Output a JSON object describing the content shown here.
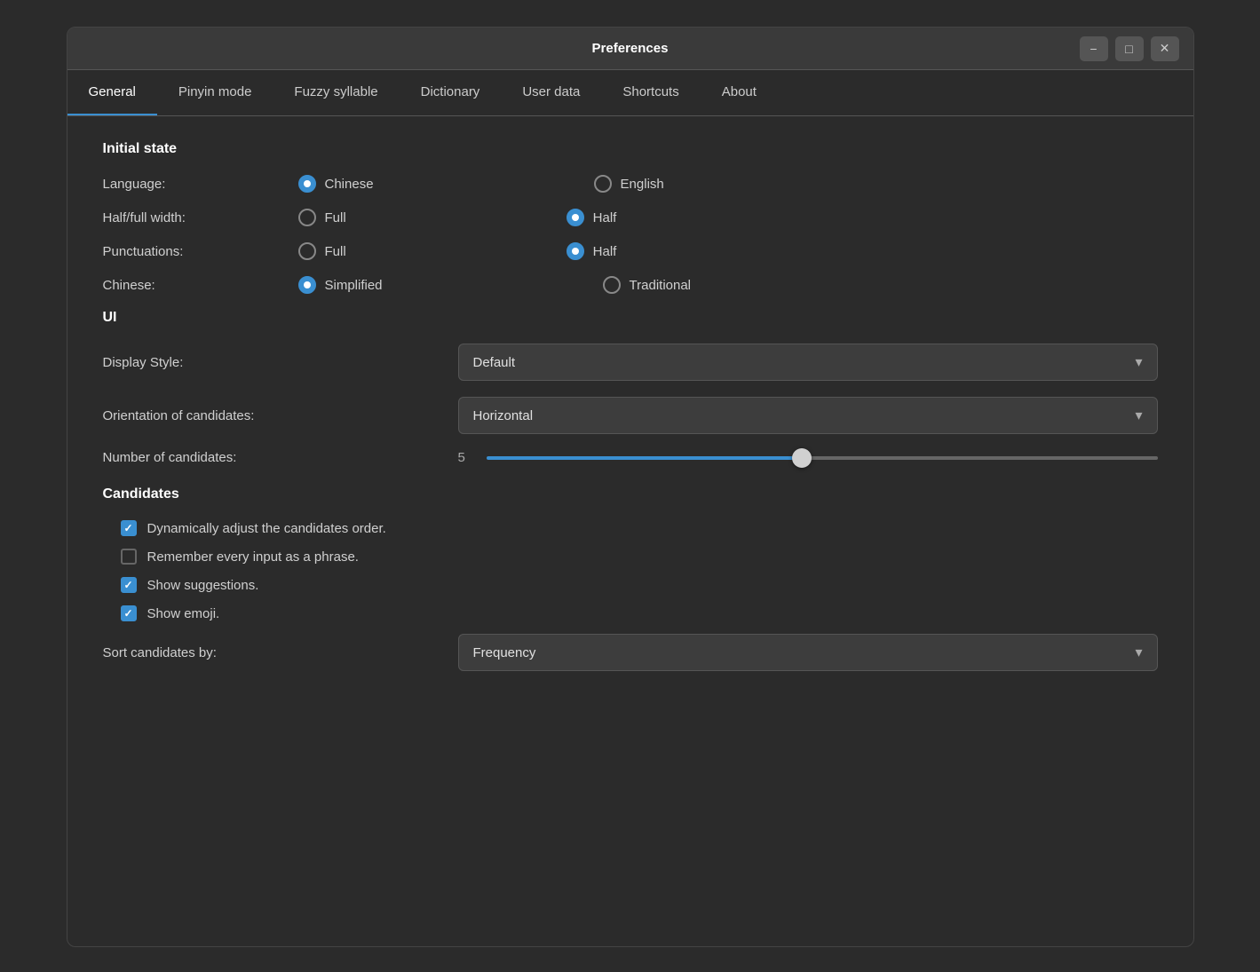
{
  "titlebar": {
    "title": "Preferences",
    "btn_minimize": "−",
    "btn_maximize": "□",
    "btn_close": "✕"
  },
  "tabs": [
    {
      "id": "general",
      "label": "General",
      "active": true
    },
    {
      "id": "pinyin",
      "label": "Pinyin mode",
      "active": false
    },
    {
      "id": "fuzzy",
      "label": "Fuzzy syllable",
      "active": false
    },
    {
      "id": "dictionary",
      "label": "Dictionary",
      "active": false
    },
    {
      "id": "userdata",
      "label": "User data",
      "active": false
    },
    {
      "id": "shortcuts",
      "label": "Shortcuts",
      "active": false
    },
    {
      "id": "about",
      "label": "About",
      "active": false
    }
  ],
  "initial_state": {
    "section_title": "Initial state",
    "language": {
      "label": "Language:",
      "options": [
        {
          "label": "Chinese",
          "selected": true
        },
        {
          "label": "English",
          "selected": false
        }
      ]
    },
    "half_full_width": {
      "label": "Half/full width:",
      "options": [
        {
          "label": "Full",
          "selected": false
        },
        {
          "label": "Half",
          "selected": true
        }
      ]
    },
    "punctuations": {
      "label": "Punctuations:",
      "options": [
        {
          "label": "Full",
          "selected": false
        },
        {
          "label": "Half",
          "selected": true
        }
      ]
    },
    "chinese": {
      "label": "Chinese:",
      "options": [
        {
          "label": "Simplified",
          "selected": true
        },
        {
          "label": "Traditional",
          "selected": false
        }
      ]
    }
  },
  "ui_section": {
    "section_title": "UI",
    "display_style": {
      "label": "Display Style:",
      "value": "Default"
    },
    "orientation": {
      "label": "Orientation of candidates:",
      "value": "Horizontal"
    },
    "num_candidates": {
      "label": "Number of candidates:",
      "value": "5",
      "slider_percent": 47
    }
  },
  "candidates_section": {
    "section_title": "Candidates",
    "checkboxes": [
      {
        "label": "Dynamically adjust the candidates order.",
        "checked": true
      },
      {
        "label": "Remember every input as a phrase.",
        "checked": false
      },
      {
        "label": "Show suggestions.",
        "checked": true
      },
      {
        "label": "Show emoji.",
        "checked": true
      }
    ],
    "sort_by": {
      "label": "Sort candidates by:",
      "value": "Frequency"
    }
  }
}
